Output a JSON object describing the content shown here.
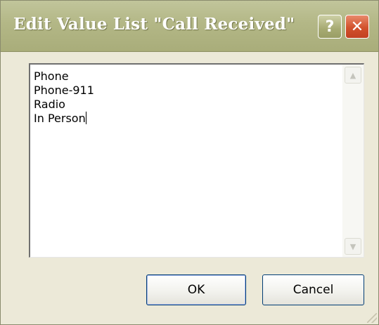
{
  "window": {
    "title": "Edit Value List \"Call Received\"",
    "help_glyph": "?",
    "close_glyph": "✕"
  },
  "editor": {
    "lines": [
      "Phone",
      "Phone-911",
      "Radio",
      "In Person"
    ],
    "scroll_up_glyph": "▲",
    "scroll_down_glyph": "▼"
  },
  "buttons": {
    "ok_label": "OK",
    "cancel_label": "Cancel"
  },
  "colors": {
    "titlebar": "#b3b786",
    "close_button": "#d2512c",
    "dialog_face": "#ece9d8",
    "default_button_border": "#003c74"
  }
}
